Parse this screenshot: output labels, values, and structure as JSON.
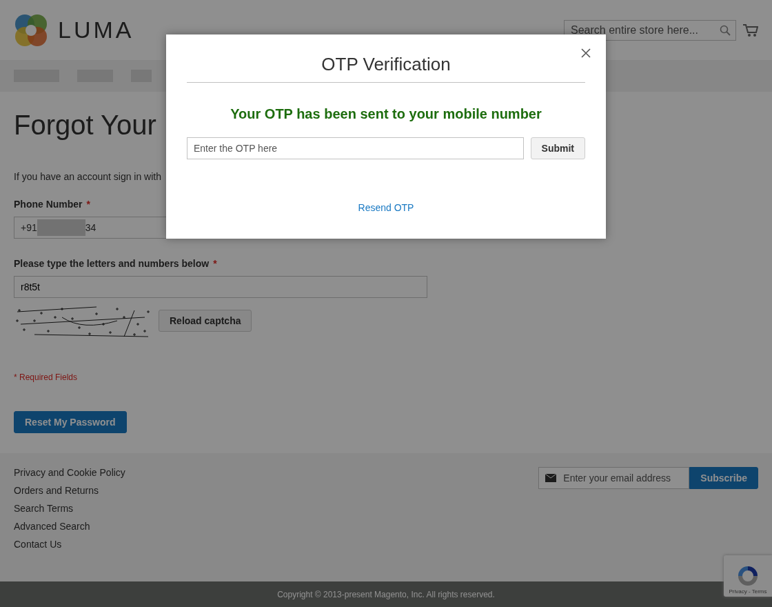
{
  "header": {
    "logo_text": "LUMA",
    "search": {
      "placeholder": "Search entire store here..."
    }
  },
  "page": {
    "title": "Forgot Your",
    "intro": "If you have an account sign in with",
    "phone": {
      "label": "Phone Number",
      "required": "*",
      "prefix": "+91",
      "suffix": "34"
    },
    "captcha": {
      "label": "Please type the letters and numbers below",
      "required": "*",
      "value": "r8t5t",
      "reload": "Reload captcha"
    },
    "required_note": "* Required Fields",
    "submit": "Reset My Password"
  },
  "footer": {
    "links": [
      "Privacy and Cookie Policy",
      "Orders and Returns",
      "Search Terms",
      "Advanced Search",
      "Contact Us"
    ],
    "newsletter": {
      "placeholder": "Enter your email address",
      "button": "Subscribe"
    },
    "recaptcha": "Privacy - Terms",
    "copyright": "Copyright © 2013-present Magento, Inc. All rights reserved."
  },
  "modal": {
    "title": "OTP Verification",
    "message": "Your OTP has been sent to your mobile number",
    "otp": {
      "placeholder": "Enter the OTP here"
    },
    "submit": "Submit",
    "resend": "Resend OTP"
  }
}
